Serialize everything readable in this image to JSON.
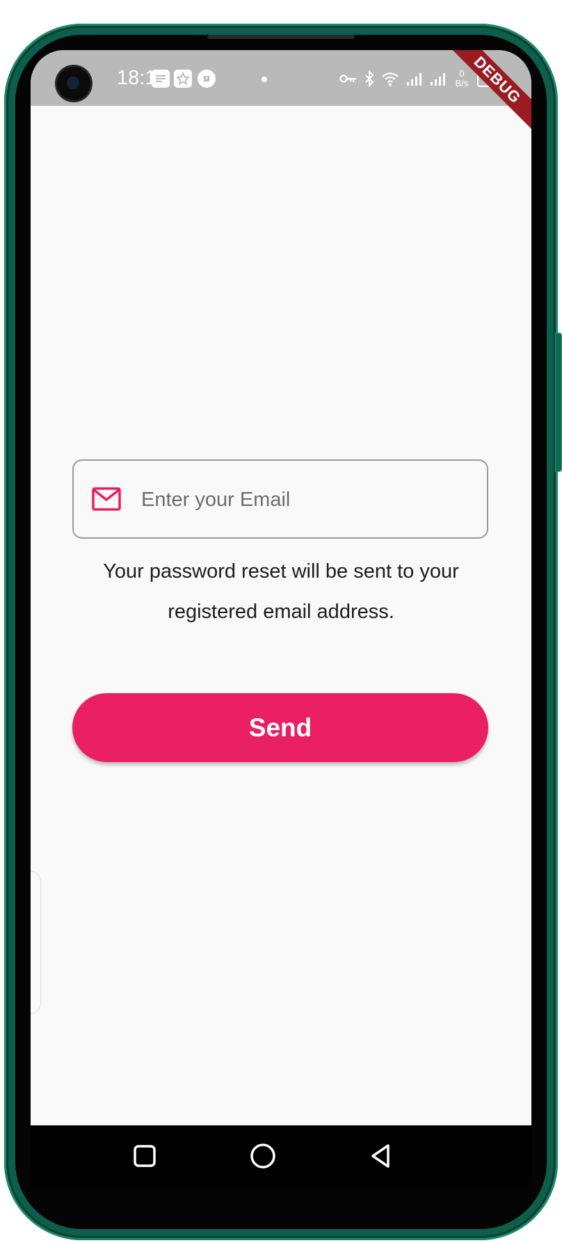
{
  "status_bar": {
    "time": "18:18",
    "notification_icons": [
      "message-icon",
      "star-app-icon",
      "download-icon",
      "more-dot-icon"
    ],
    "system_icons": [
      "vpn-key-icon",
      "bluetooth-icon",
      "wifi-icon",
      "signal-icon",
      "signal-icon"
    ],
    "net_speed_value": "0",
    "net_speed_unit": "B/s",
    "battery": "61"
  },
  "debug_banner": "DEBUG",
  "email_field": {
    "icon": "mail-icon",
    "placeholder": "Enter your Email",
    "value": ""
  },
  "helper_text": "Your password reset will be sent to your registered email address.",
  "send_button": {
    "label": "Send"
  },
  "colors": {
    "accent": "#e91e63",
    "background": "#f9f9f9",
    "status_bar": "#b9b9b9",
    "frame": "#0d5e4a"
  },
  "nav_bar": {
    "buttons": [
      "recents-square-icon",
      "home-circle-icon",
      "back-triangle-icon"
    ]
  }
}
